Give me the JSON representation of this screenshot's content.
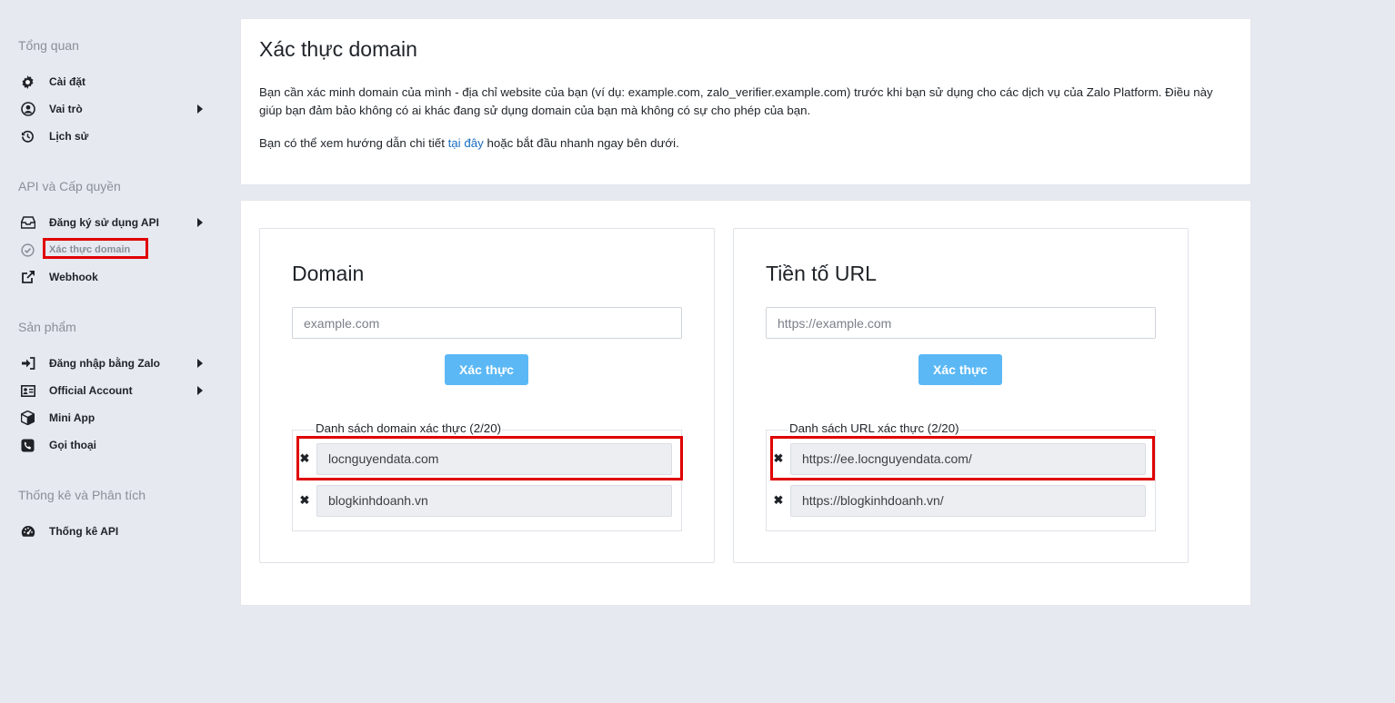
{
  "sidebar": {
    "sections": [
      {
        "title": "Tổng quan"
      },
      {
        "title": "API và Cấp quyền"
      },
      {
        "title": "Sản phẩm"
      },
      {
        "title": "Thống kê và Phân tích"
      }
    ],
    "items": [
      {
        "label": "Cài đặt",
        "icon": "gear-icon"
      },
      {
        "label": "Vai trò",
        "icon": "user-circle-icon"
      },
      {
        "label": "Lịch sử",
        "icon": "history-icon"
      },
      {
        "label": "Đăng ký sử dụng API",
        "icon": "inbox-icon"
      },
      {
        "label": "Xác thực domain",
        "icon": "check-circle-icon"
      },
      {
        "label": "Webhook",
        "icon": "external-link-icon"
      },
      {
        "label": "Đăng nhập bằng Zalo",
        "icon": "sign-in-icon"
      },
      {
        "label": "Official Account",
        "icon": "id-card-icon"
      },
      {
        "label": "Mini App",
        "icon": "cube-icon"
      },
      {
        "label": "Gọi thoại",
        "icon": "phone-icon"
      },
      {
        "label": "Thống kê API",
        "icon": "dashboard-icon"
      }
    ]
  },
  "header": {
    "title": "Xác thực domain",
    "description": "Bạn cần xác minh domain của mình - địa chỉ website của bạn (ví dụ: example.com, zalo_verifier.example.com) trước khi bạn sử dụng cho các dịch vụ của Zalo Platform. Điều này giúp bạn đảm bảo không có ai khác đang sử dụng domain của bạn mà không có sự cho phép của bạn.",
    "guide_prefix": "Bạn có thể xem hướng dẫn chi tiết ",
    "guide_link": "tại đây",
    "guide_suffix": " hoặc bắt đầu nhanh ngay bên dưới."
  },
  "domain_panel": {
    "title": "Domain",
    "placeholder": "example.com",
    "button": "Xác thực",
    "list_label": "Danh sách domain xác thực (2/20)",
    "entries": [
      "locnguyendata.com",
      "blogkinhdoanh.vn"
    ]
  },
  "url_panel": {
    "title": "Tiền tố URL",
    "placeholder": "https://example.com",
    "button": "Xác thực",
    "list_label": "Danh sách URL xác thực (2/20)",
    "entries": [
      "https://ee.locnguyendata.com/",
      "https://blogkinhdoanh.vn/"
    ]
  },
  "colors": {
    "accent": "#5bb8f5",
    "highlight": "#e00000",
    "link": "#1b6ec2"
  }
}
